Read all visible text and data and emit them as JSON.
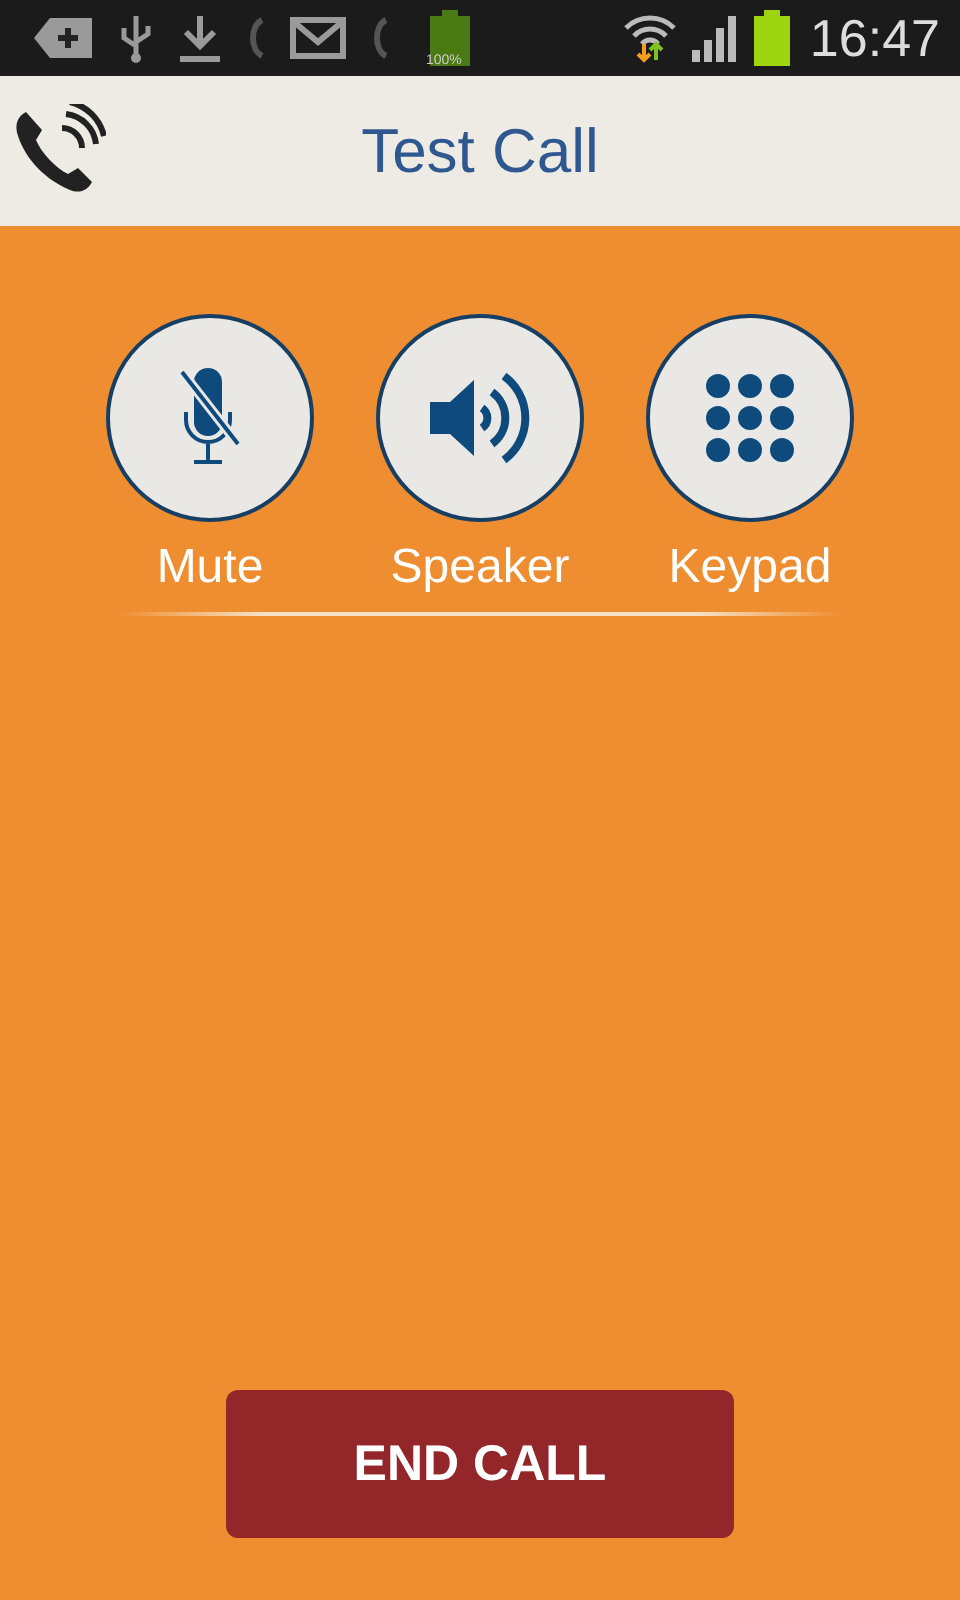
{
  "status_bar": {
    "battery_text": "100%",
    "time": "16:47"
  },
  "app_bar": {
    "title": "Test Call"
  },
  "controls": [
    {
      "kind": "mute",
      "label": "Mute"
    },
    {
      "kind": "speaker",
      "label": "Speaker"
    },
    {
      "kind": "keypad",
      "label": "Keypad"
    }
  ],
  "end_button": {
    "label": "END CALL"
  }
}
